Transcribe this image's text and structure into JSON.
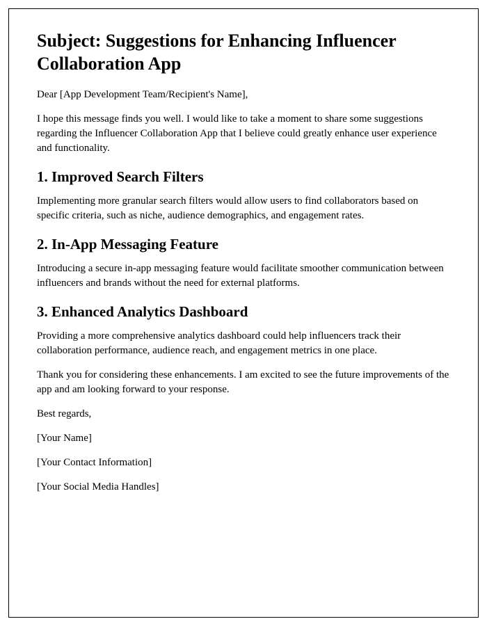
{
  "subject": "Subject: Suggestions for Enhancing Influencer Collaboration App",
  "greeting": "Dear [App Development Team/Recipient's Name],",
  "intro": "I hope this message finds you well. I would like to take a moment to share some suggestions regarding the Influencer Collaboration App that I believe could greatly enhance user experience and functionality.",
  "sections": [
    {
      "heading": "1. Improved Search Filters",
      "body": "Implementing more granular search filters would allow users to find collaborators based on specific criteria, such as niche, audience demographics, and engagement rates."
    },
    {
      "heading": "2. In-App Messaging Feature",
      "body": "Introducing a secure in-app messaging feature would facilitate smoother communication between influencers and brands without the need for external platforms."
    },
    {
      "heading": "3. Enhanced Analytics Dashboard",
      "body": "Providing a more comprehensive analytics dashboard could help influencers track their collaboration performance, audience reach, and engagement metrics in one place."
    }
  ],
  "closing": "Thank you for considering these enhancements. I am excited to see the future improvements of the app and am looking forward to your response.",
  "signoff": "Best regards,",
  "name": "[Your Name]",
  "contact": "[Your Contact Information]",
  "social": "[Your Social Media Handles]"
}
